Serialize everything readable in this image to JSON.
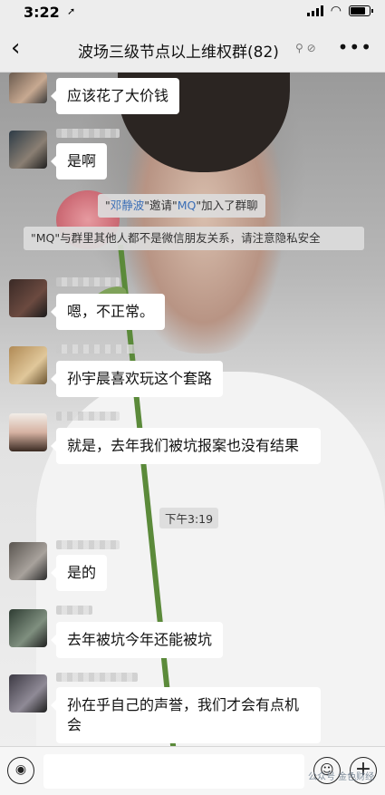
{
  "status_bar": {
    "time": "3:22",
    "location_icon": "location-arrow-icon",
    "signal_icon": "cellular-signal-icon",
    "wifi_icon": "wifi-icon",
    "battery_icon": "battery-icon"
  },
  "nav": {
    "back_icon": "‹",
    "title": "波场三级节点以上维权群(82)",
    "extra_icons": "⚲ ⊘",
    "more_icon": "•••"
  },
  "messages": [
    {
      "type": "text",
      "text": "应该花了大价钱"
    },
    {
      "type": "text",
      "text": "是啊"
    },
    {
      "type": "system_invite",
      "inviter": "邓静波",
      "mid1": "\"邀请\"",
      "invitee": "MQ",
      "tail": "\"加入了群聊"
    },
    {
      "type": "system",
      "text": "\"MQ\"与群里其他人都不是微信朋友关系，请注意隐私安全"
    },
    {
      "type": "text",
      "text": "嗯，不正常。"
    },
    {
      "type": "text",
      "text": "孙宇晨喜欢玩这个套路"
    },
    {
      "type": "text",
      "text": "就是，去年我们被坑报案也没有结果"
    },
    {
      "type": "time",
      "text": "下午3:19"
    },
    {
      "type": "text",
      "text": "是的"
    },
    {
      "type": "text",
      "text": "去年被坑今年还能被坑"
    },
    {
      "type": "text",
      "text": "孙在乎自己的声誉，我们才会有点机会"
    }
  ],
  "input_bar": {
    "voice_icon": "◉",
    "emoji_icon": "☺",
    "plus_icon": "+",
    "input_value": ""
  },
  "watermark": "公众号 金色财经"
}
